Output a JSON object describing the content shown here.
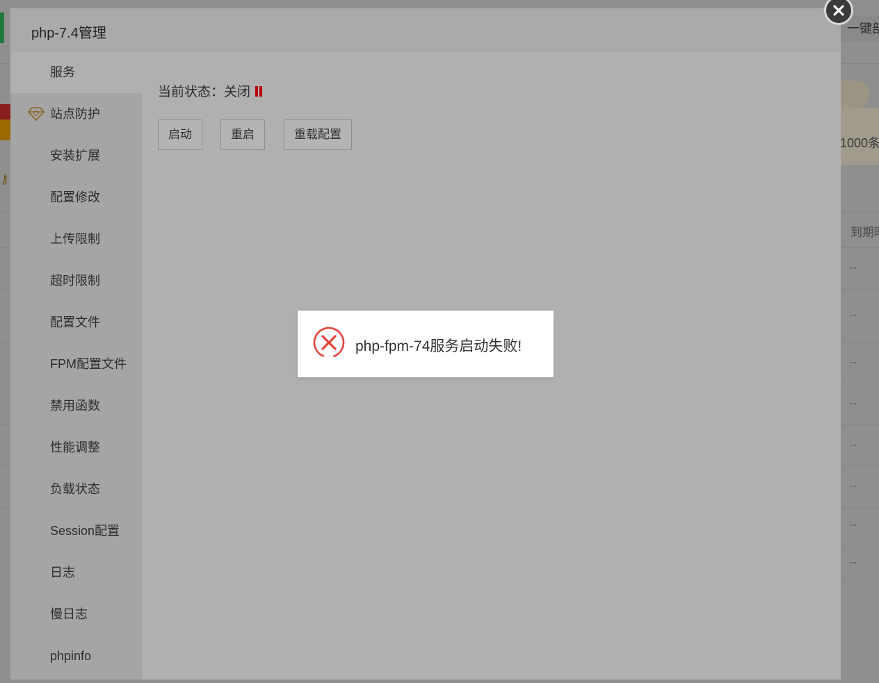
{
  "background": {
    "top_right_button": "一键部",
    "count_text": "1000条",
    "column_header": "到期时",
    "row_placeholder": "--"
  },
  "modal": {
    "title": "php-7.4管理",
    "sidebar": [
      {
        "label": "服务",
        "active": true
      },
      {
        "label": "站点防护",
        "icon": "gem-icon"
      },
      {
        "label": "安装扩展"
      },
      {
        "label": "配置修改"
      },
      {
        "label": "上传限制"
      },
      {
        "label": "超时限制"
      },
      {
        "label": "配置文件"
      },
      {
        "label": "FPM配置文件"
      },
      {
        "label": "禁用函数"
      },
      {
        "label": "性能调整"
      },
      {
        "label": "负载状态"
      },
      {
        "label": "Session配置"
      },
      {
        "label": "日志"
      },
      {
        "label": "慢日志"
      },
      {
        "label": "phpinfo"
      }
    ],
    "status_text": "当前状态：关闭",
    "status_icon": "pause-icon",
    "status_color": "#b8000a",
    "buttons": {
      "start": "启动",
      "restart": "重启",
      "reload": "重载配置"
    },
    "close_icon": "close-icon"
  },
  "toast": {
    "icon": "error-circle-icon",
    "icon_color": "#e0433a",
    "message": "php-fpm-74服务启动失败!"
  }
}
